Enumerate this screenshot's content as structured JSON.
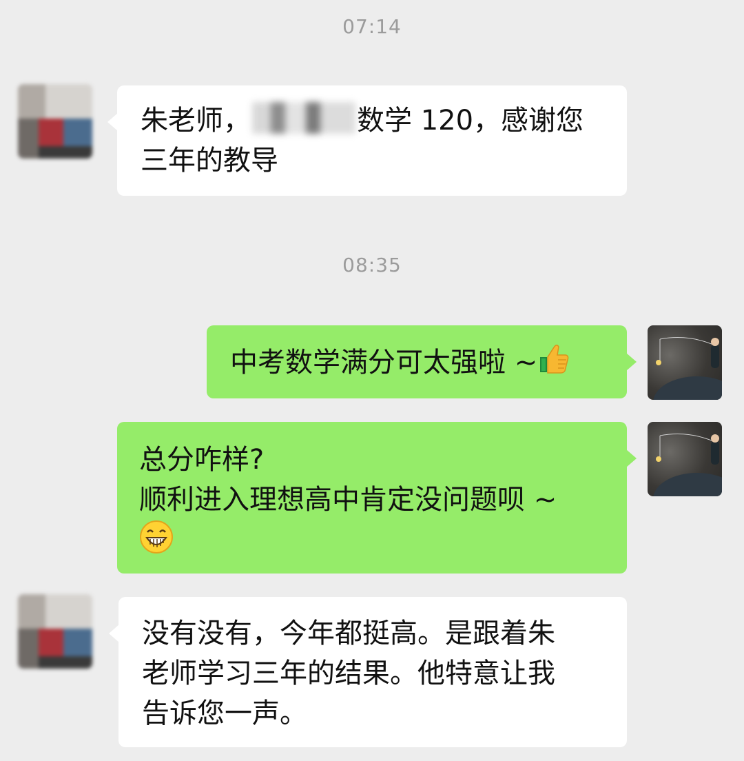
{
  "chat": {
    "time_1": "07:14",
    "time_2": "08:35",
    "msg_1": {
      "line1_before": "朱老师，",
      "line1_after": "数学 120，感谢您",
      "line2": "三年的教导"
    },
    "msg_2": {
      "text": "中考数学满分可太强啦 ~",
      "emoji": "thumbs-up-icon"
    },
    "msg_3": {
      "line1": "总分咋样?",
      "line2": "顺利进入理想高中肯定没问题呗 ~",
      "emoji": "grinning-face-icon"
    },
    "msg_4": {
      "line1": "没有没有，今年都挺高。是跟着朱",
      "line2": "老师学习三年的结果。他特意让我",
      "line3": "告诉您一声。"
    }
  },
  "colors": {
    "background": "#ededed",
    "incoming_bubble": "#ffffff",
    "outgoing_bubble": "#95ec69",
    "timestamp_text": "#9b9b9b"
  }
}
